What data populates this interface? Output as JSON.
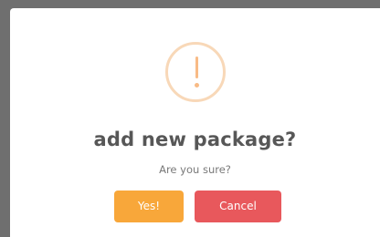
{
  "dialog": {
    "icon": "exclamation-warning-icon",
    "title": "add new package?",
    "message": "Are you sure?",
    "confirm_label": "Yes!",
    "cancel_label": "Cancel"
  },
  "colors": {
    "confirm": "#f8a73a",
    "cancel": "#e8585c",
    "warning_icon": "#f8bb86",
    "title": "#575757",
    "message": "#797979"
  }
}
